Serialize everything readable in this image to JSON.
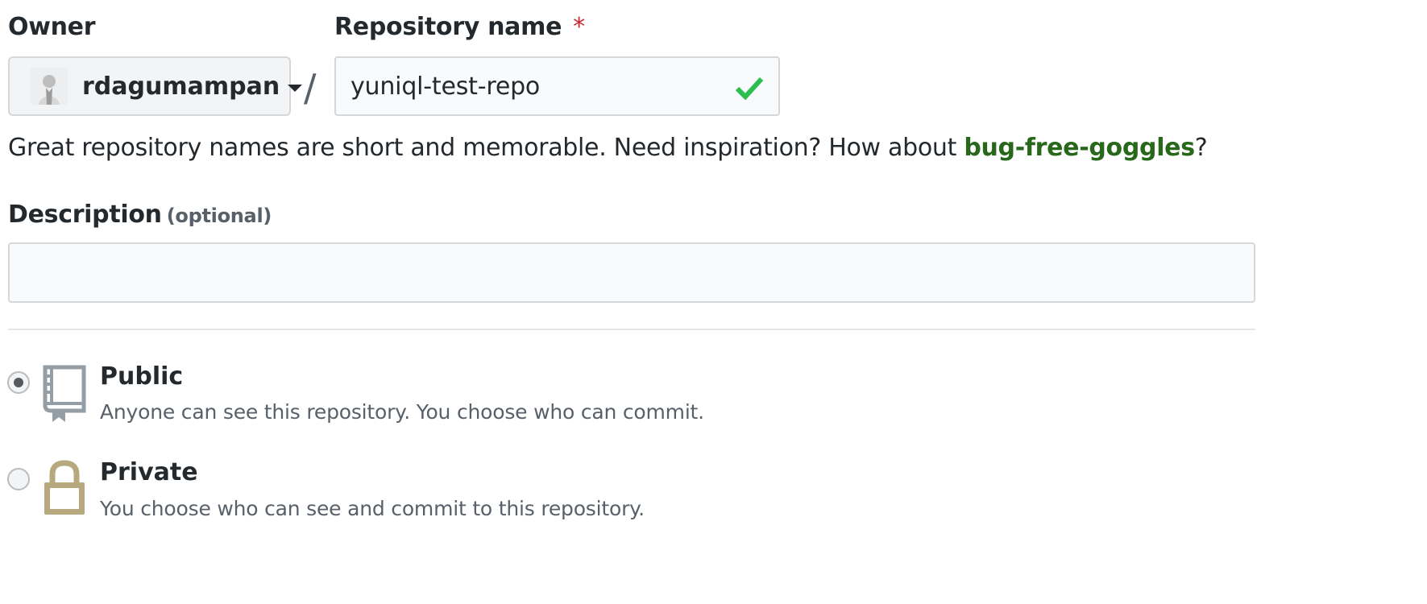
{
  "owner": {
    "label": "Owner",
    "username": "rdagumampan"
  },
  "repository": {
    "label": "Repository name",
    "required_mark": "*",
    "separator": "/",
    "name_value": "yuniql-test-repo"
  },
  "hint": {
    "text": "Great repository names are short and memorable. Need inspiration? How about ",
    "suggestion": "bug-free-goggles",
    "suffix": "?"
  },
  "description": {
    "label": "Description",
    "optional": "(optional)",
    "value": ""
  },
  "visibility": {
    "options": [
      {
        "title": "Public",
        "description": "Anyone can see this repository. You choose who can commit.",
        "icon": "repo-book-icon",
        "selected": true
      },
      {
        "title": "Private",
        "description": "You choose who can see and commit to this repository.",
        "icon": "lock-icon",
        "selected": false
      }
    ]
  },
  "colors": {
    "success_check": "#2cbe4e",
    "suggestion_link": "#28681a",
    "required_star": "#cb2431",
    "lock_icon": "#b7a87e",
    "repo_icon": "#959da5"
  }
}
